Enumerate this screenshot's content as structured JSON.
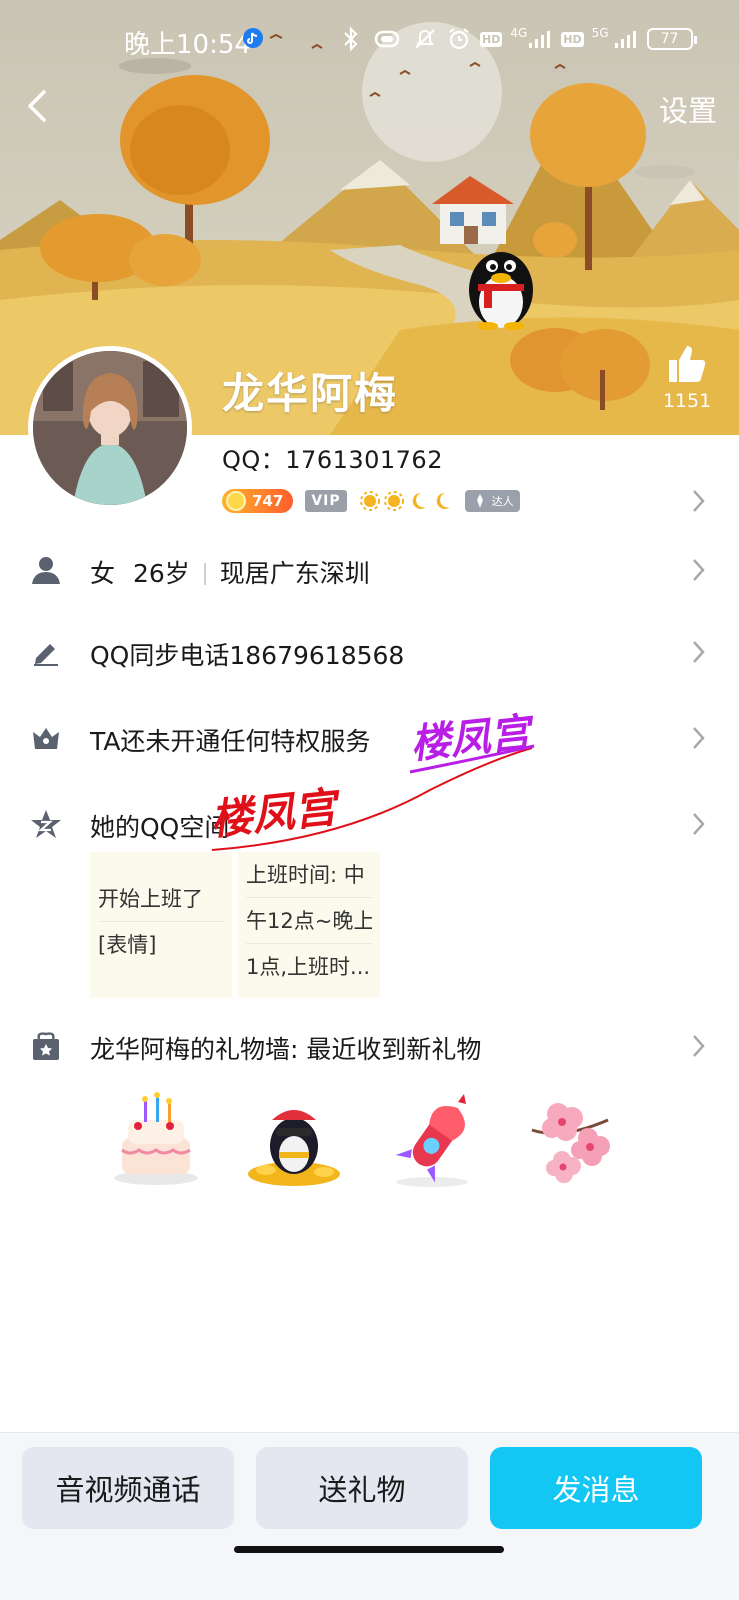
{
  "status_bar": {
    "time": "晚上10:54",
    "net_4g": "4G",
    "net_5g": "5G",
    "hd": "HD",
    "battery": "77"
  },
  "header": {
    "back_icon": "back-arrow-icon",
    "settings_label": "设置"
  },
  "profile": {
    "nickname": "龙华阿梅",
    "qq_label": "QQ：1761301762",
    "level": "747",
    "vip_label": "VIP",
    "daren_label": "达人",
    "likes": "1151"
  },
  "rows": {
    "gender": "女",
    "age": "26岁",
    "location": "现居广东深圳",
    "signature": "QQ同步电话18679618568",
    "privilege": "TA还未开通任何特权服务",
    "qzone": "她的QQ空间",
    "gift_wall": "龙华阿梅的礼物墙: 最近收到新礼物"
  },
  "qzone_posts": [
    {
      "lines": [
        "开始上班了",
        "[表情]"
      ]
    },
    {
      "lines": [
        "上班时间: 中",
        "午12点~晚上",
        "1点,上班时..."
      ]
    }
  ],
  "gifts": [
    "cake-gift-icon",
    "penguin-coins-gift-icon",
    "rocket-gift-icon",
    "blossom-gift-icon"
  ],
  "watermark": {
    "text1": "楼凤宫",
    "text2": "楼凤宫"
  },
  "bottom_bar": {
    "call_label": "音视频通话",
    "gift_label": "送礼物",
    "message_label": "发消息"
  },
  "colors": {
    "accent": "#13c7f5",
    "watermark_red": "#e0101a",
    "watermark_purple": "#b81ee6"
  }
}
